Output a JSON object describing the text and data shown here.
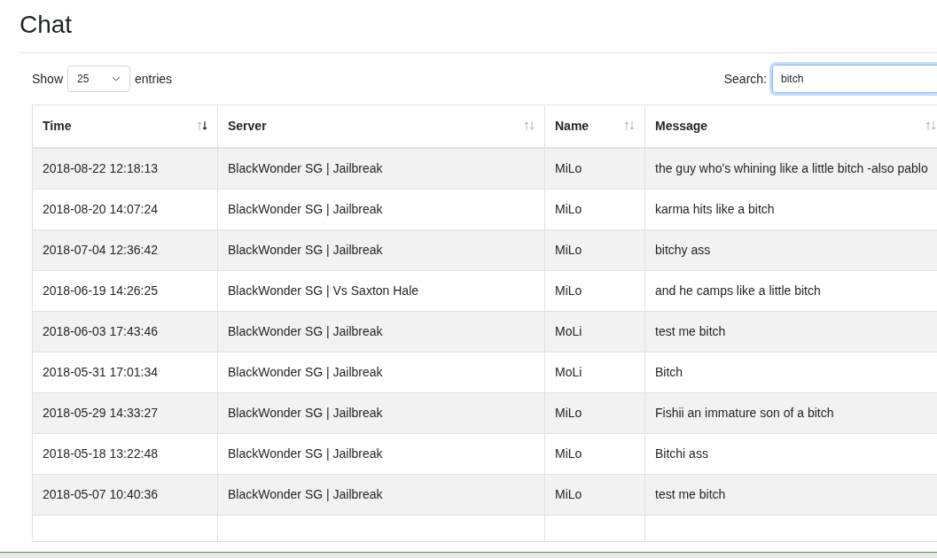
{
  "title": "Chat",
  "length": {
    "label_before": "Show",
    "value": "25",
    "label_after": "entries"
  },
  "search": {
    "label": "Search:",
    "value": "bitch"
  },
  "columns": [
    {
      "label": "Time",
      "sorted_descending": true
    },
    {
      "label": "Server",
      "sorted_descending": false
    },
    {
      "label": "Name",
      "sorted_descending": false
    },
    {
      "label": "Message",
      "sorted_descending": false
    }
  ],
  "rows": [
    [
      "2018-08-22 12:18:13",
      "BlackWonder SG | Jailbreak",
      "MiLo",
      "the guy who's whining like a little bitch -also pablo"
    ],
    [
      "2018-08-20 14:07:24",
      "BlackWonder SG | Jailbreak",
      "MiLo",
      "karma hits like a bitch"
    ],
    [
      "2018-07-04 12:36:42",
      "BlackWonder SG | Jailbreak",
      "MiLo",
      "bitchy ass"
    ],
    [
      "2018-06-19 14:26:25",
      "BlackWonder SG | Vs Saxton Hale",
      "MiLo",
      "and he camps like a little bitch"
    ],
    [
      "2018-06-03 17:43:46",
      "BlackWonder SG | Jailbreak",
      "MoLi",
      "test me bitch"
    ],
    [
      "2018-05-31 17:01:34",
      "BlackWonder SG | Jailbreak",
      "MoLi",
      "Bitch"
    ],
    [
      "2018-05-29 14:33:27",
      "BlackWonder SG | Jailbreak",
      "MiLo",
      "Fishii an immature son of a bitch"
    ],
    [
      "2018-05-18 13:22:48",
      "BlackWonder SG | Jailbreak",
      "MiLo",
      "Bitchi ass"
    ],
    [
      "2018-05-07 10:40:36",
      "BlackWonder SG | Jailbreak",
      "MiLo",
      "test me bitch"
    ]
  ]
}
